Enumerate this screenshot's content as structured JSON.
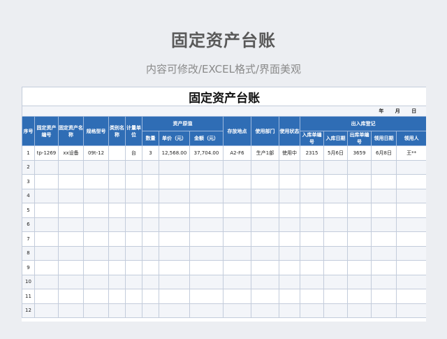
{
  "hero": {
    "title": "固定资产台账",
    "subtitle": "内容可修改/EXCEL格式/界面美观"
  },
  "sheet": {
    "title": "固定资产台账",
    "date_labels": [
      "年",
      "月",
      "日"
    ],
    "headers": {
      "seq": "序号",
      "code": "固定资产编号",
      "name": "固定资产名称",
      "model": "规格型号",
      "category": "类别名称",
      "unit": "计量单位",
      "original_value": "资产原值",
      "qty": "数量",
      "unit_price": "单价（元）",
      "amount": "金额（元）",
      "location": "存放地点",
      "department": "使用部门",
      "status": "使用状态",
      "inout": "出入库登记",
      "in_no": "入库单编号",
      "in_date": "入库日期",
      "out_no": "出库单编号",
      "use_date": "领用日期",
      "user": "领用人"
    },
    "rows": [
      {
        "seq": "1",
        "code": "tp-1269",
        "name": "xx设备",
        "model": "09t-12",
        "category": "",
        "unit": "台",
        "qty": "3",
        "unit_price": "12,568.00",
        "amount": "37,704.00",
        "location": "A2-F6",
        "department": "生产1部",
        "status": "使用中",
        "in_no": "2315",
        "in_date": "5月6日",
        "out_no": "3659",
        "use_date": "6月8日",
        "user": "王**"
      },
      {
        "seq": "2",
        "code": "",
        "name": "",
        "model": "",
        "category": "",
        "unit": "",
        "qty": "",
        "unit_price": "",
        "amount": "",
        "location": "",
        "department": "",
        "status": "",
        "in_no": "",
        "in_date": "",
        "out_no": "",
        "use_date": "",
        "user": ""
      },
      {
        "seq": "3",
        "code": "",
        "name": "",
        "model": "",
        "category": "",
        "unit": "",
        "qty": "",
        "unit_price": "",
        "amount": "",
        "location": "",
        "department": "",
        "status": "",
        "in_no": "",
        "in_date": "",
        "out_no": "",
        "use_date": "",
        "user": ""
      },
      {
        "seq": "4",
        "code": "",
        "name": "",
        "model": "",
        "category": "",
        "unit": "",
        "qty": "",
        "unit_price": "",
        "amount": "",
        "location": "",
        "department": "",
        "status": "",
        "in_no": "",
        "in_date": "",
        "out_no": "",
        "use_date": "",
        "user": ""
      },
      {
        "seq": "5",
        "code": "",
        "name": "",
        "model": "",
        "category": "",
        "unit": "",
        "qty": "",
        "unit_price": "",
        "amount": "",
        "location": "",
        "department": "",
        "status": "",
        "in_no": "",
        "in_date": "",
        "out_no": "",
        "use_date": "",
        "user": ""
      },
      {
        "seq": "6",
        "code": "",
        "name": "",
        "model": "",
        "category": "",
        "unit": "",
        "qty": "",
        "unit_price": "",
        "amount": "",
        "location": "",
        "department": "",
        "status": "",
        "in_no": "",
        "in_date": "",
        "out_no": "",
        "use_date": "",
        "user": ""
      },
      {
        "seq": "7",
        "code": "",
        "name": "",
        "model": "",
        "category": "",
        "unit": "",
        "qty": "",
        "unit_price": "",
        "amount": "",
        "location": "",
        "department": "",
        "status": "",
        "in_no": "",
        "in_date": "",
        "out_no": "",
        "use_date": "",
        "user": ""
      },
      {
        "seq": "8",
        "code": "",
        "name": "",
        "model": "",
        "category": "",
        "unit": "",
        "qty": "",
        "unit_price": "",
        "amount": "",
        "location": "",
        "department": "",
        "status": "",
        "in_no": "",
        "in_date": "",
        "out_no": "",
        "use_date": "",
        "user": ""
      },
      {
        "seq": "9",
        "code": "",
        "name": "",
        "model": "",
        "category": "",
        "unit": "",
        "qty": "",
        "unit_price": "",
        "amount": "",
        "location": "",
        "department": "",
        "status": "",
        "in_no": "",
        "in_date": "",
        "out_no": "",
        "use_date": "",
        "user": ""
      },
      {
        "seq": "10",
        "code": "",
        "name": "",
        "model": "",
        "category": "",
        "unit": "",
        "qty": "",
        "unit_price": "",
        "amount": "",
        "location": "",
        "department": "",
        "status": "",
        "in_no": "",
        "in_date": "",
        "out_no": "",
        "use_date": "",
        "user": ""
      },
      {
        "seq": "11",
        "code": "",
        "name": "",
        "model": "",
        "category": "",
        "unit": "",
        "qty": "",
        "unit_price": "",
        "amount": "",
        "location": "",
        "department": "",
        "status": "",
        "in_no": "",
        "in_date": "",
        "out_no": "",
        "use_date": "",
        "user": ""
      },
      {
        "seq": "12",
        "code": "",
        "name": "",
        "model": "",
        "category": "",
        "unit": "",
        "qty": "",
        "unit_price": "",
        "amount": "",
        "location": "",
        "department": "",
        "status": "",
        "in_no": "",
        "in_date": "",
        "out_no": "",
        "use_date": "",
        "user": ""
      }
    ]
  },
  "colors": {
    "header_bg": "#2f6db5",
    "page_bg": "#eceef2",
    "alt_row": "#f3f5f9"
  }
}
